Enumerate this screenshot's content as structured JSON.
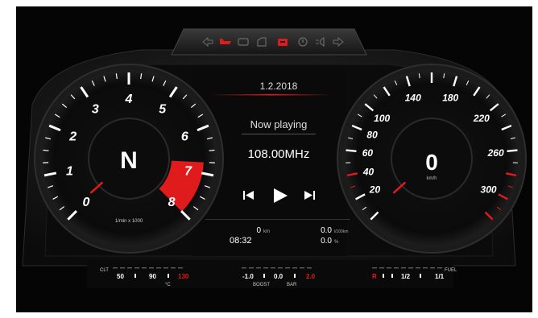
{
  "date": "1.2.2018",
  "media": {
    "status": "Now playing",
    "station": "108.00MHz"
  },
  "gear": "N",
  "tachometer": {
    "labels": [
      "0",
      "1",
      "2",
      "3",
      "4",
      "5",
      "6",
      "7",
      "8"
    ],
    "unit": "1/min x 1000",
    "redline_from": 7
  },
  "speedometer": {
    "labels": [
      "20",
      "40",
      "60",
      "80",
      "100",
      "140",
      "180",
      "220",
      "260",
      "300"
    ],
    "speed": "0",
    "unit": "km/h"
  },
  "trip": {
    "distance": "0",
    "distance_unit": "km",
    "time": "08:32",
    "consumption": "0.0",
    "consumption_unit": "l/100km",
    "avg": "0.0",
    "avg_unit": "%"
  },
  "coolant": {
    "title": "CLT",
    "labels": [
      "50",
      "90",
      "130"
    ],
    "unit": "°C"
  },
  "boost": {
    "labels": [
      "-1.0",
      "0.0",
      "2.0"
    ],
    "title": "BOOST",
    "unit": "BAR"
  },
  "fuel": {
    "title": "FUEL",
    "labels": [
      "R",
      "1/2",
      "1/1"
    ]
  },
  "indicators": [
    "left-turn-icon",
    "oil-pressure-icon",
    "engine-icon",
    "door-icon",
    "battery-icon",
    "brake-icon",
    "headlight-icon",
    "right-turn-icon"
  ],
  "colors": {
    "accent": "#e01b1b",
    "background": "#0a0a0a",
    "text": "#ffffff"
  }
}
